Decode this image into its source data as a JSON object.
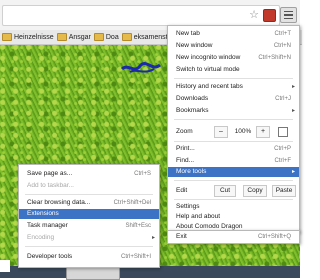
{
  "bookmarks_bar": {
    "items": [
      {
        "label": "Heinzelnisse",
        "icon": "folder-icon"
      },
      {
        "label": "Ansgar",
        "icon": "folder-icon"
      },
      {
        "label": "Doa",
        "icon": "folder-icon"
      },
      {
        "label": "eksamenstid",
        "icon": "folder-icon"
      }
    ]
  },
  "main_menu": {
    "new_tab": {
      "label": "New tab",
      "shortcut": "Ctrl+T"
    },
    "new_window": {
      "label": "New window",
      "shortcut": "Ctrl+N"
    },
    "new_incognito": {
      "label": "New incognito window",
      "shortcut": "Ctrl+Shift+N"
    },
    "switch_virtual": {
      "label": "Switch to virtual mode"
    },
    "history": {
      "label": "History and recent tabs"
    },
    "downloads": {
      "label": "Downloads",
      "shortcut": "Ctrl+J"
    },
    "bookmarks": {
      "label": "Bookmarks"
    },
    "zoom": {
      "label": "Zoom",
      "minus": "–",
      "value": "100%",
      "plus": "+"
    },
    "print": {
      "label": "Print...",
      "shortcut": "Ctrl+P"
    },
    "find": {
      "label": "Find...",
      "shortcut": "Ctrl+F"
    },
    "more_tools": {
      "label": "More tools"
    },
    "edit": {
      "label": "Edit",
      "cut": "Cut",
      "copy": "Copy",
      "paste": "Paste"
    },
    "settings": {
      "label": "Settings"
    },
    "help": {
      "label": "Help and about"
    },
    "about": {
      "label": "About Comodo Dragon"
    },
    "exit": {
      "label": "Exit",
      "shortcut": "Ctrl+Shift+Q"
    }
  },
  "sub_menu": {
    "save_page": {
      "label": "Save page as...",
      "shortcut": "Ctrl+S"
    },
    "add_taskbar": {
      "label": "Add to taskbar..."
    },
    "clear_data": {
      "label": "Clear browsing data...",
      "shortcut": "Ctrl+Shift+Del"
    },
    "extensions": {
      "label": "Extensions"
    },
    "task_manager": {
      "label": "Task manager",
      "shortcut": "Shift+Esc"
    },
    "encoding": {
      "label": "Encoding"
    },
    "dev_tools": {
      "label": "Developer tools",
      "shortcut": "Ctrl+Shift+I"
    }
  },
  "colors": {
    "highlight": "#3d73c5",
    "grass": "#76b52a"
  }
}
